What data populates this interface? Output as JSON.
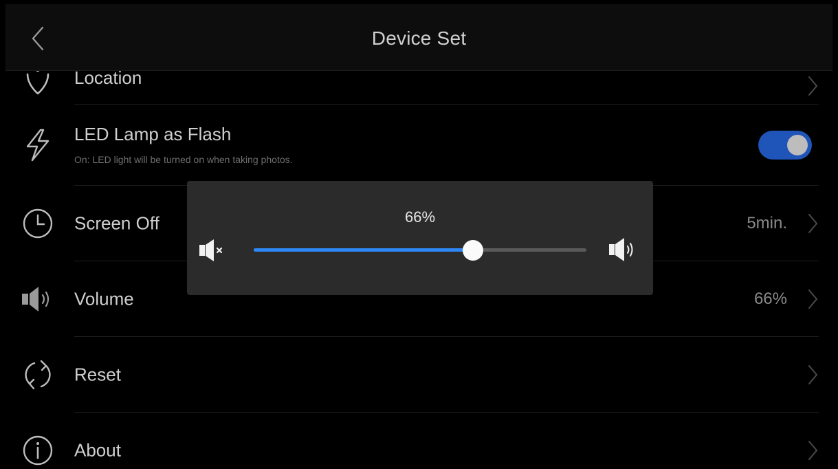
{
  "header": {
    "title": "Device Set"
  },
  "settings": {
    "location": {
      "label": "Location"
    },
    "led_flash": {
      "label": "LED Lamp as Flash",
      "description": "On: LED light will be turned on when taking photos.",
      "enabled": true
    },
    "screen_off": {
      "label": "Screen Off",
      "value": "5min."
    },
    "volume": {
      "label": "Volume",
      "value": "66%"
    },
    "reset": {
      "label": "Reset"
    },
    "about": {
      "label": "About"
    }
  },
  "volume_popup": {
    "value_text": "66%",
    "level_percent": 66
  },
  "colors": {
    "background": "#000000",
    "toggle_on": "#1f54b8",
    "slider_fill": "#2f86f5",
    "popup_bg": "#2b2b2b"
  }
}
